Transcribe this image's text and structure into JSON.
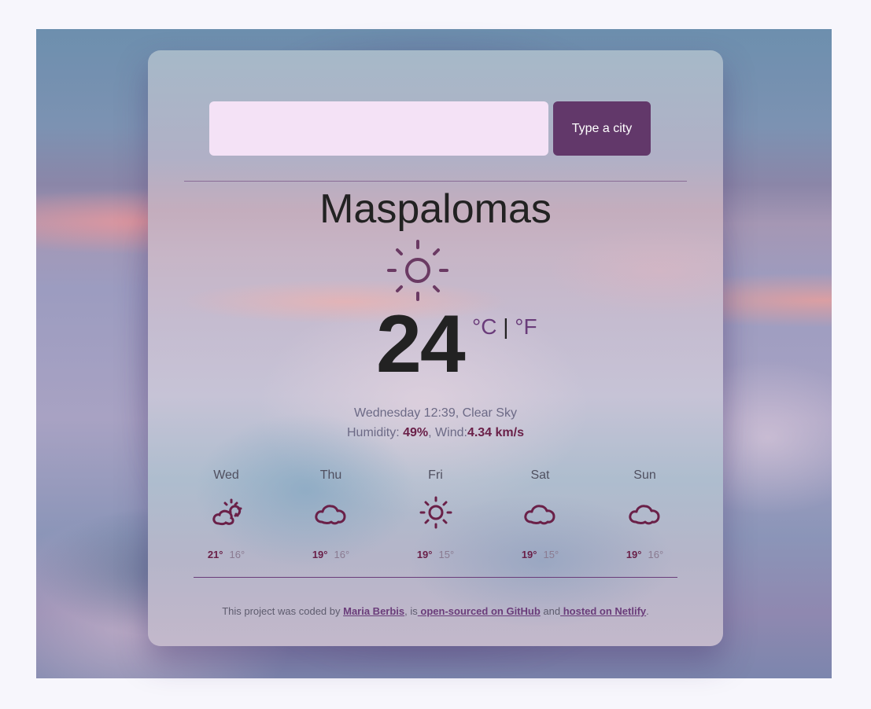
{
  "search": {
    "value": "",
    "placeholder": "",
    "button_label": "Type a city"
  },
  "current": {
    "city": "Maspalomas",
    "icon": "sun-icon",
    "temperature": "24",
    "unit_celsius": "°C",
    "unit_separator": "|",
    "unit_fahrenheit": "°F",
    "datetime_condition": "Wednesday 12:39, Clear Sky",
    "humidity_label": "Humidity: ",
    "humidity_value": "49%",
    "wind_label": ", Wind:",
    "wind_value": "4.34 km/s"
  },
  "forecast": [
    {
      "day": "Wed",
      "icon": "partly-cloudy-icon",
      "max": "21°",
      "min": "16°"
    },
    {
      "day": "Thu",
      "icon": "cloud-icon",
      "max": "19°",
      "min": "16°"
    },
    {
      "day": "Fri",
      "icon": "sun-icon",
      "max": "19°",
      "min": "15°"
    },
    {
      "day": "Sat",
      "icon": "cloud-icon",
      "max": "19°",
      "min": "15°"
    },
    {
      "day": "Sun",
      "icon": "cloud-icon",
      "max": "19°",
      "min": "16°"
    }
  ],
  "footer": {
    "text_1": "This project was coded by ",
    "author_link": "Maria Berbis",
    "text_2": ", is",
    "github_link": " open-sourced on GitHub",
    "text_3": " and",
    "netlify_link": " hosted on Netlify",
    "text_4": "."
  },
  "colors": {
    "accent": "#62386a",
    "input_bg": "#f4e2f6",
    "icon": "#6a2048",
    "page_bg": "#f7f6fc"
  }
}
